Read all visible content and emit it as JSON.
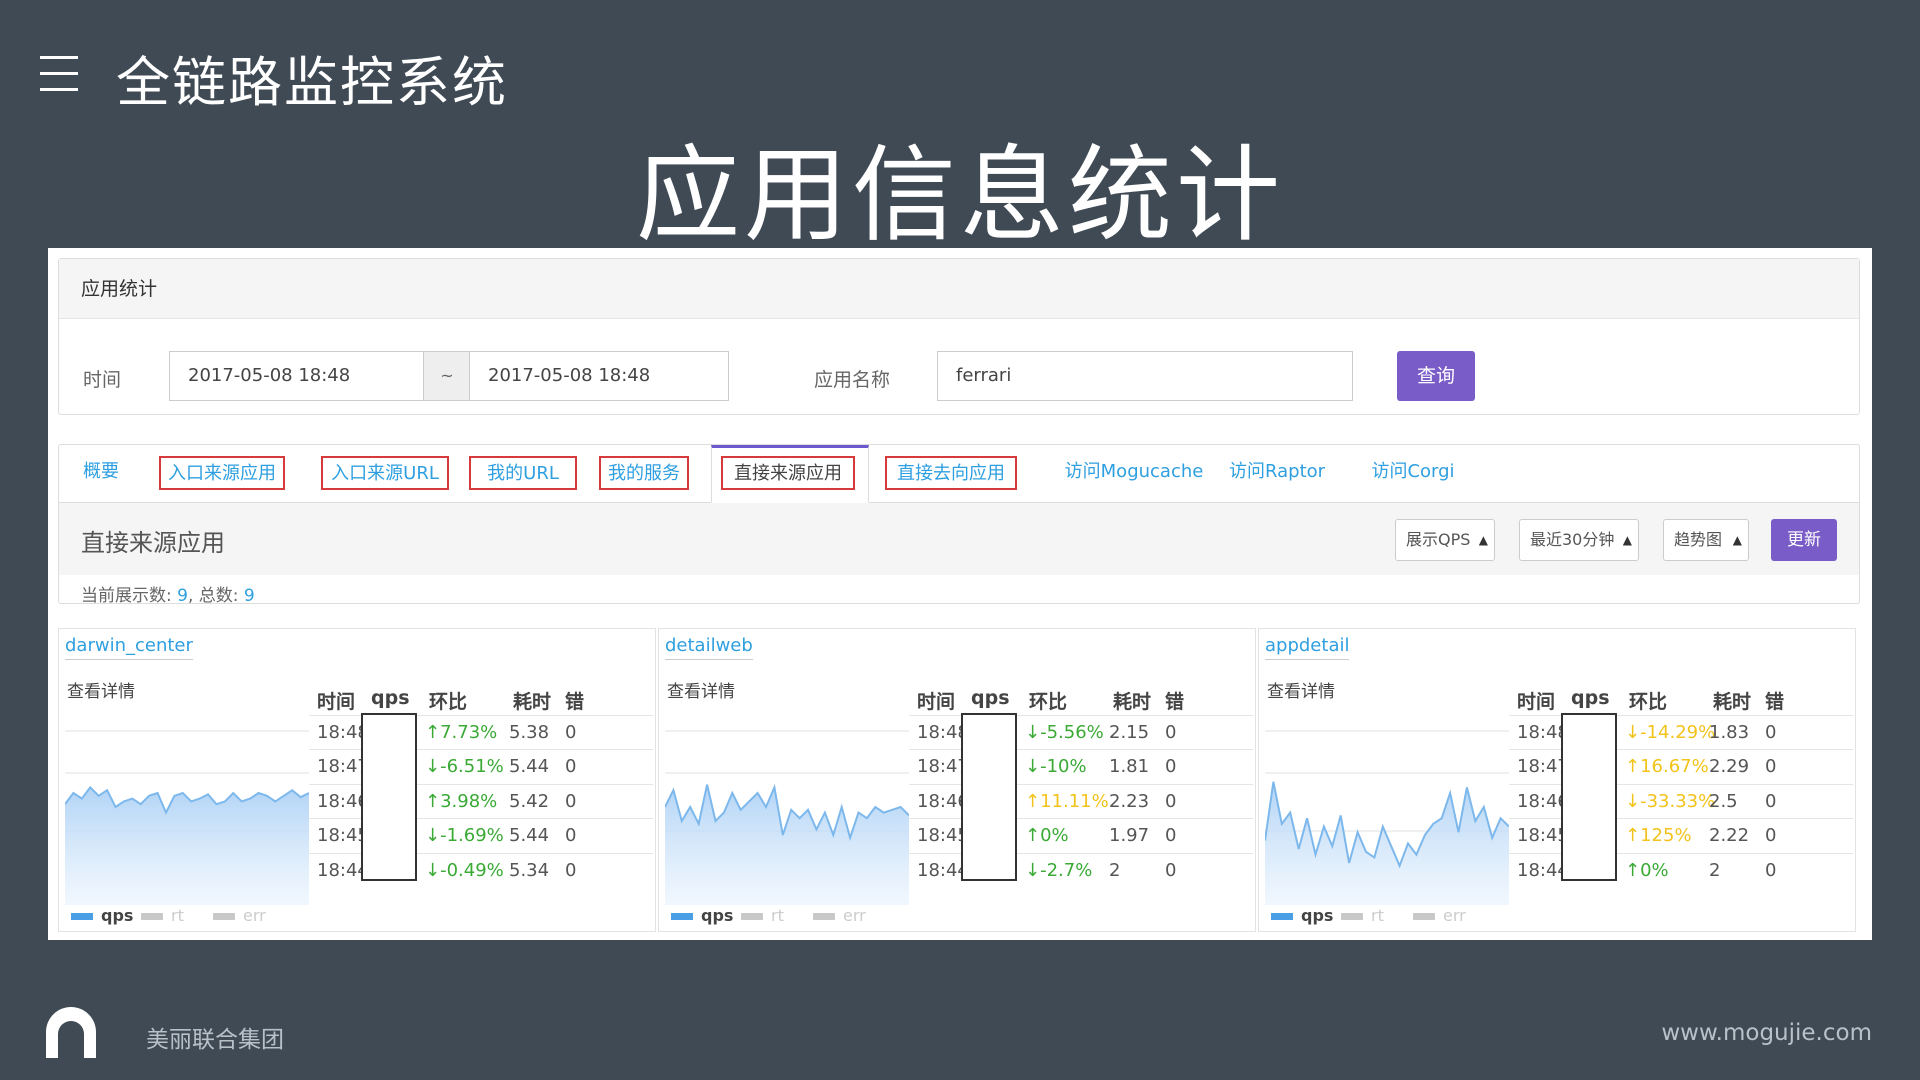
{
  "deck": {
    "menu_icon": "menu-icon",
    "title": "全链路监控系统",
    "slide_title": "应用信息统计"
  },
  "query_panel": {
    "heading": "应用统计",
    "time_label": "时间",
    "start_time": "2017-05-08 18:48",
    "separator": "~",
    "end_time": "2017-05-08 18:48",
    "app_name_label": "应用名称",
    "app_name_value": "ferrari",
    "query_button": "查询"
  },
  "tabs": [
    {
      "label": "概要",
      "boxed": false,
      "active": false
    },
    {
      "label": "入口来源应用",
      "boxed": true,
      "active": false
    },
    {
      "label": "入口来源URL",
      "boxed": true,
      "active": false
    },
    {
      "label": "我的URL",
      "boxed": true,
      "active": false
    },
    {
      "label": "我的服务",
      "boxed": true,
      "active": false
    },
    {
      "label": "直接来源应用",
      "boxed": true,
      "active": true
    },
    {
      "label": "直接去向应用",
      "boxed": true,
      "active": false
    },
    {
      "label": "访问Mogucache",
      "boxed": false,
      "active": false
    },
    {
      "label": "访问Raptor",
      "boxed": false,
      "active": false
    },
    {
      "label": "访问Corgi",
      "boxed": false,
      "active": false
    }
  ],
  "section": {
    "title": "直接来源应用",
    "select_metric": "展示QPS",
    "select_range": "最近30分钟",
    "select_view": "趋势图",
    "update_button": "更新",
    "count_prefix": "当前展示数: ",
    "shown": "9",
    "total_prefix": ", 总数: ",
    "total": "9"
  },
  "table_headers": {
    "time": "时间",
    "qps": "qps",
    "ratio": "环比",
    "cost": "耗时",
    "err": "错"
  },
  "legend": {
    "qps": "qps",
    "rt": "rt",
    "err": "err"
  },
  "colors": {
    "up": "#3aaa35",
    "warn": "#f2c31a",
    "link": "#2e9fe0",
    "accent": "#7a5cc8",
    "chart_line": "#7db8ec"
  },
  "cards": [
    {
      "name": "darwin_center",
      "detail": "查看详情",
      "rows": [
        {
          "time": "18:48",
          "ratio": "↑7.73%",
          "cost": "5.38",
          "err": "0",
          "tone": "up"
        },
        {
          "time": "18:47",
          "ratio": "↓-6.51%",
          "cost": "5.44",
          "err": "0",
          "tone": "up"
        },
        {
          "time": "18:46",
          "ratio": "↑3.98%",
          "cost": "5.42",
          "err": "0",
          "tone": "up"
        },
        {
          "time": "18:45",
          "ratio": "↓-1.69%",
          "cost": "5.44",
          "err": "0",
          "tone": "up"
        },
        {
          "time": "18:44",
          "ratio": "↓-0.49%",
          "cost": "5.34",
          "err": "0",
          "tone": "up"
        }
      ],
      "series": [
        72,
        80,
        76,
        84,
        78,
        82,
        70,
        74,
        76,
        72,
        78,
        80,
        66,
        78,
        80,
        74,
        76,
        79,
        72,
        74,
        80,
        74,
        76,
        80,
        78,
        74,
        78,
        82,
        77,
        80
      ]
    },
    {
      "name": "detailweb",
      "detail": "查看详情",
      "rows": [
        {
          "time": "18:48",
          "ratio": "↓-5.56%",
          "cost": "2.15",
          "err": "0",
          "tone": "up"
        },
        {
          "time": "18:47",
          "ratio": "↓-10%",
          "cost": "1.81",
          "err": "0",
          "tone": "up"
        },
        {
          "time": "18:46",
          "ratio": "↑11.11%",
          "cost": "2.23",
          "err": "0",
          "tone": "warn"
        },
        {
          "time": "18:45",
          "ratio": "↑0%",
          "cost": "1.97",
          "err": "0",
          "tone": "up"
        },
        {
          "time": "18:44",
          "ratio": "↓-2.7%",
          "cost": "2",
          "err": "0",
          "tone": "up"
        }
      ],
      "series": [
        70,
        82,
        60,
        70,
        58,
        86,
        60,
        66,
        80,
        68,
        74,
        80,
        70,
        84,
        50,
        68,
        62,
        68,
        54,
        66,
        50,
        70,
        48,
        66,
        62,
        70,
        66,
        68,
        70,
        64
      ]
    },
    {
      "name": "appdetail",
      "detail": "查看详情",
      "rows": [
        {
          "time": "18:48",
          "ratio": "↓-14.29%",
          "cost": "1.83",
          "err": "0",
          "tone": "warn"
        },
        {
          "time": "18:47",
          "ratio": "↑16.67%",
          "cost": "2.29",
          "err": "0",
          "tone": "warn"
        },
        {
          "time": "18:46",
          "ratio": "↓-33.33%",
          "cost": "2.5",
          "err": "0",
          "tone": "warn"
        },
        {
          "time": "18:45",
          "ratio": "↑125%",
          "cost": "2.22",
          "err": "0",
          "tone": "warn"
        },
        {
          "time": "18:44",
          "ratio": "↑0%",
          "cost": "2",
          "err": "0",
          "tone": "up"
        }
      ],
      "series": [
        46,
        88,
        58,
        66,
        40,
        62,
        36,
        56,
        42,
        64,
        30,
        52,
        38,
        34,
        56,
        42,
        28,
        44,
        36,
        50,
        58,
        62,
        80,
        52,
        84,
        60,
        70,
        48,
        62,
        56
      ]
    }
  ],
  "footer": {
    "logo_icon": "mogujie-logo-icon",
    "brand": "美丽联合集团",
    "url": "www.mogujie.com"
  }
}
